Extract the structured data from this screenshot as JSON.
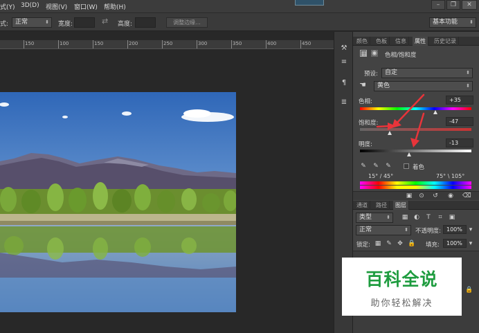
{
  "menu": {
    "items": [
      "式(Y)",
      "3D(D)",
      "视图(V)",
      "窗口(W)",
      "帮助(H)"
    ],
    "window_buttons": [
      "–",
      "❐",
      "✕"
    ]
  },
  "options": {
    "mode_label": "式:",
    "mode_value": "正常",
    "width_label": "宽度:",
    "swap_icon": "swap-arrows-icon",
    "height_label": "高度:",
    "refine_edge": "调整边缘...",
    "workspace": "基本功能"
  },
  "ruler": {
    "ticks": [
      "150",
      "100",
      "150",
      "200",
      "250",
      "300",
      "350",
      "400",
      "450",
      "500",
      "550"
    ]
  },
  "properties_tabs": [
    "颜色",
    "色板",
    "信息",
    "属性",
    "历史记录"
  ],
  "properties": {
    "panel_title": "色相/饱和度",
    "preset_label": "预设:",
    "preset_value": "自定",
    "channel_value": "黄色",
    "hue_label": "色相:",
    "hue_value": "+35",
    "saturation_label": "饱和度:",
    "saturation_value": "-47",
    "lightness_label": "明度:",
    "lightness_value": "-13",
    "colorize_label": "着色",
    "range_left": "15° / 45°",
    "range_right": "75° \\ 105°"
  },
  "slider_levels": {
    "hue": 0.68,
    "saturation": 0.27,
    "lightness": 0.44
  },
  "layers_tabs": [
    "通道",
    "路径",
    "图层"
  ],
  "layers": {
    "filter_label": "类型",
    "blend_mode": "正常",
    "opacity_label": "不透明度:",
    "opacity_value": "100%",
    "lock_label": "锁定:",
    "fill_label": "填充:",
    "fill_value": "100%"
  },
  "watermark": {
    "title": "百科全说",
    "subtitle": "助你轻松解决"
  },
  "colors": {
    "accent_arrow": "#e8343a",
    "watermark_green": "#1e9c3f",
    "sky_top": "#2f67b8",
    "sky_bottom": "#9ec3e6"
  }
}
